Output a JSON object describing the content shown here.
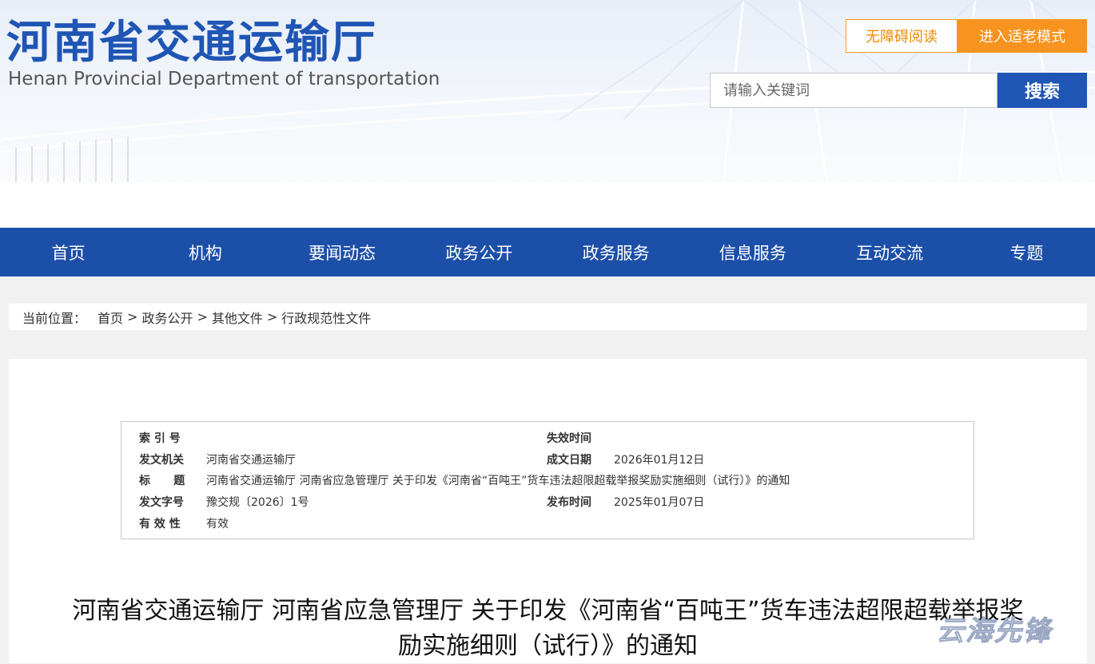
{
  "header": {
    "title": "河南省交通运输厅",
    "subtitle": "Henan Provincial Department of transportation",
    "accessible_label": "无障碍阅读",
    "elder_mode_label": "进入适老模式",
    "search": {
      "placeholder": "请输入关键词",
      "button_label": "搜索"
    }
  },
  "nav": {
    "items": [
      "首页",
      "机构",
      "要闻动态",
      "政务公开",
      "政务服务",
      "信息服务",
      "互动交流",
      "专题"
    ]
  },
  "breadcrumb": {
    "prefix": "当前位置：",
    "items": [
      "首页",
      "政务公开",
      "其他文件",
      "行政规范性文件"
    ],
    "separator": ">"
  },
  "meta": {
    "index_label": "索 引 号",
    "index_value": "",
    "expire_label": "失效时间",
    "expire_value": "",
    "issuer_label": "发文机关",
    "issuer_value": "河南省交通运输厅",
    "date_label": "成文日期",
    "date_value": "2026年01月12日",
    "title_label": "标      题",
    "title_value": "河南省交通运输厅 河南省应急管理厅 关于印发《河南省“百吨王”货车违法超限超载举报奖励实施细则（试行）》的通知",
    "docno_label": "发文字号",
    "docno_value": "豫交规〔2026〕1号",
    "publish_label": "发布时间",
    "publish_value": "2025年01月07日",
    "validity_label": "有 效 性",
    "validity_value": "有效"
  },
  "document": {
    "title_line1": "河南省交通运输厅 河南省应急管理厅 关于印发《河南省“百吨王”货车违法超限超载举报奖",
    "title_line2": "励实施细则（试行）》的通知"
  },
  "watermark": {
    "text": "云海先锋"
  },
  "colors": {
    "brand_blue": "#1f55b4",
    "nav_blue": "#1c4fa8",
    "accent_orange": "#f7931e"
  }
}
